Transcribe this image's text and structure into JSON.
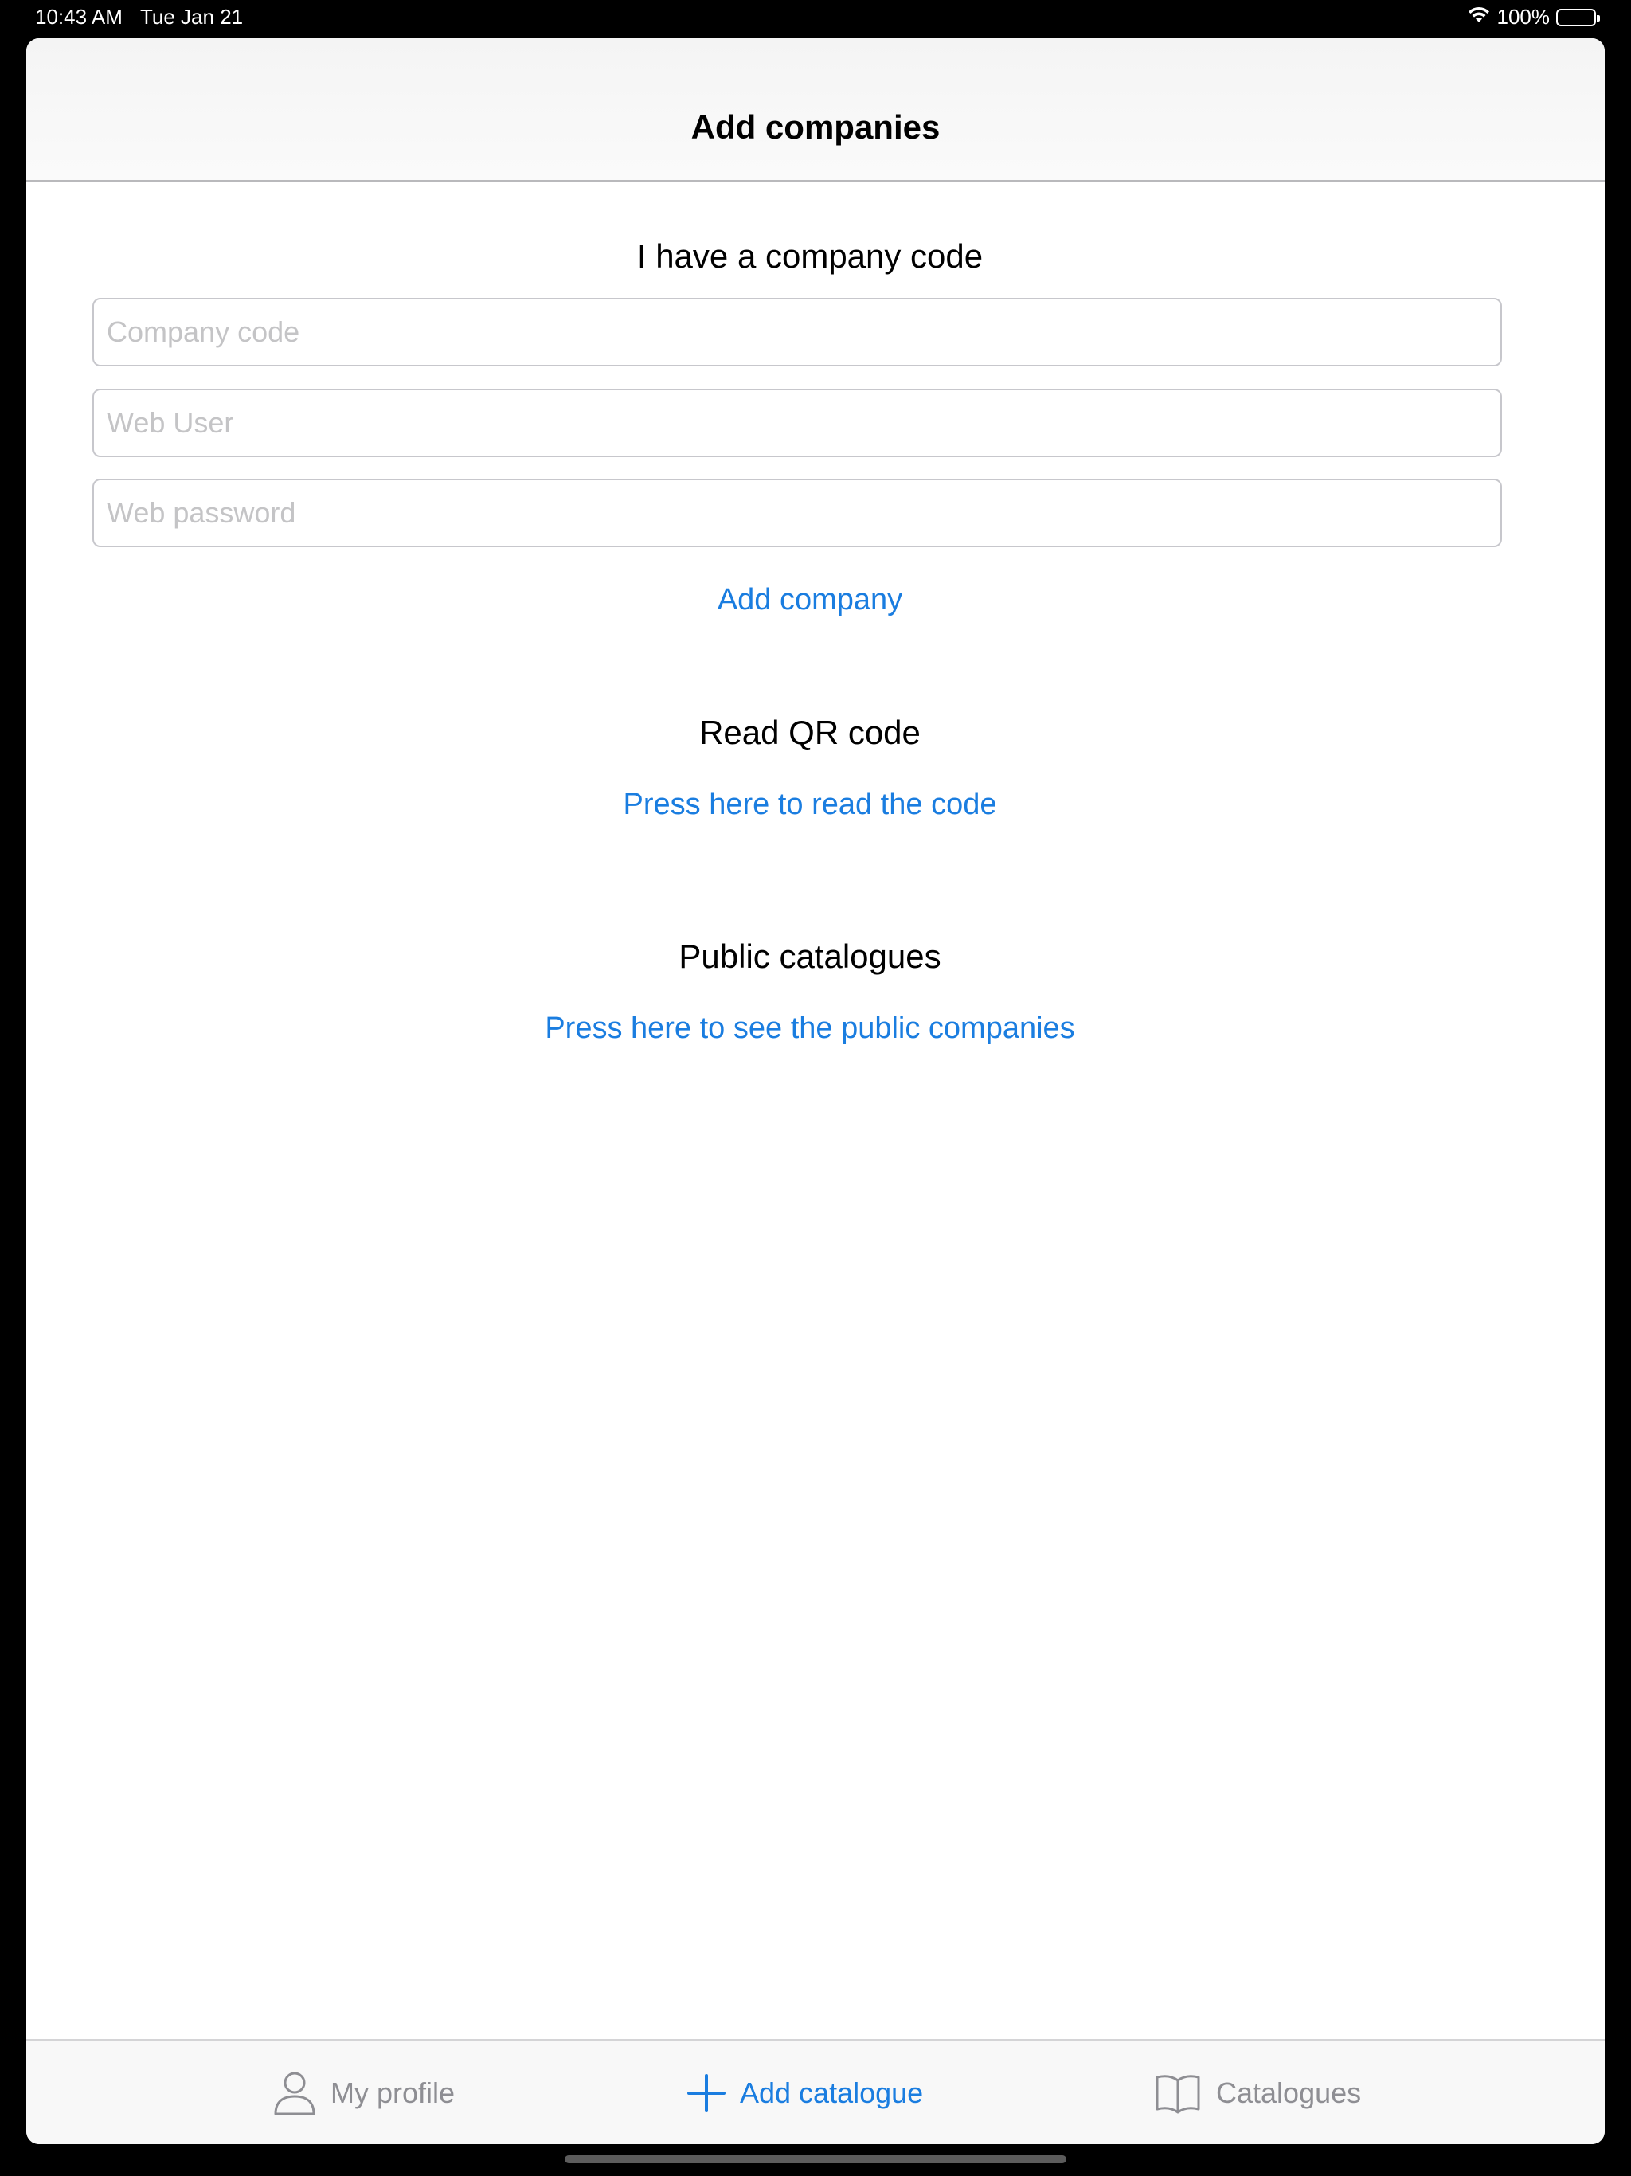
{
  "status_bar": {
    "time": "10:43 AM",
    "date": "Tue Jan 21",
    "battery": "100%",
    "icons": [
      "wifi-icon",
      "battery-icon"
    ]
  },
  "nav": {
    "title": "Add companies"
  },
  "company_code_section": {
    "title": "I have a company code",
    "company_code_placeholder": "Company code",
    "company_code_value": "",
    "web_user_placeholder": "Web User",
    "web_user_value": "",
    "web_password_placeholder": "Web password",
    "web_password_value": "",
    "add_company_label": "Add company"
  },
  "qr_section": {
    "title": "Read QR code",
    "link": "Press here to read the code"
  },
  "public_section": {
    "title": "Public catalogues",
    "link": "Press here to see the public companies"
  },
  "tab_bar": {
    "tabs": [
      {
        "label": "My profile",
        "icon": "person-icon",
        "selected": false
      },
      {
        "label": "Add catalogue",
        "icon": "plus-icon",
        "selected": true
      },
      {
        "label": "Catalogues",
        "icon": "book-icon",
        "selected": false
      }
    ]
  },
  "colors": {
    "accent": "#1a7de0",
    "inactive_tab": "#8e8e93",
    "placeholder": "#c4c4c6"
  }
}
